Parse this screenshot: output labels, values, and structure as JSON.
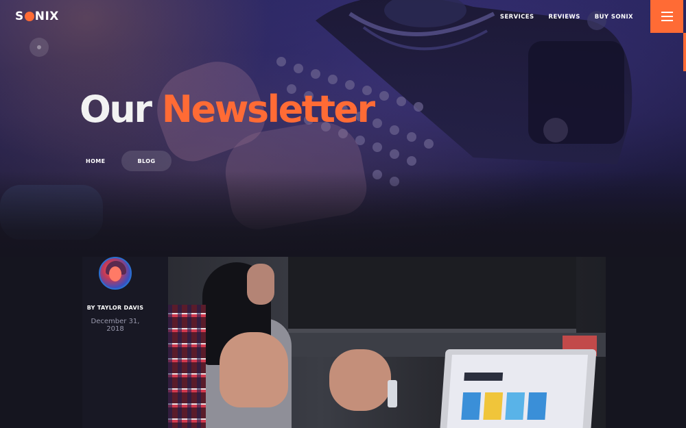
{
  "brand": {
    "logo_text_left": "S",
    "logo_text_right": "NIX",
    "accent": "#ff6b35"
  },
  "nav": {
    "items": [
      "SERVICES",
      "REVIEWS",
      "BUY SONIX"
    ],
    "menu_icon": "hamburger-icon"
  },
  "hero": {
    "title_part1": "Our",
    "title_part2": "Newsletter",
    "breadcrumbs": [
      "HOME",
      "BLOG"
    ]
  },
  "post": {
    "author": "BY TAYLOR DAVIS",
    "date": "December 31, 2018"
  }
}
